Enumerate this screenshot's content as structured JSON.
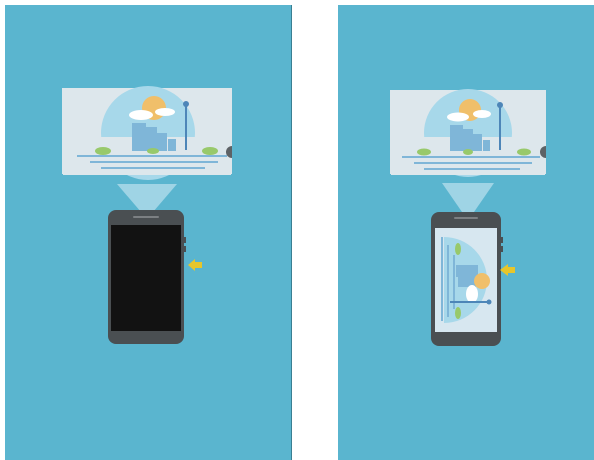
{
  "panels": [
    {
      "id": "left",
      "phone_screen": "off",
      "colors": {
        "background": "#5ab5cf",
        "phone_body": "#4a4f52",
        "screen_off": "#121212",
        "arrow": "#e7c62b"
      }
    },
    {
      "id": "right",
      "phone_screen": "on-rotated",
      "colors": {
        "background": "#5ab5cf",
        "phone_body": "#4a4f52",
        "screen_on": "#d7e7f0",
        "arrow": "#e7c62b"
      }
    }
  ],
  "illustration": {
    "icons": [
      "cityscape-illustration",
      "sun-icon",
      "cloud-icon",
      "tower-icon",
      "arrow-left-icon"
    ],
    "colors": {
      "card": "#dde7ec",
      "sky_circle": "#a7d8ea",
      "sun": "#f0bf6a",
      "buildings": "#7fb6d8",
      "bushes": "#98c96b"
    }
  }
}
